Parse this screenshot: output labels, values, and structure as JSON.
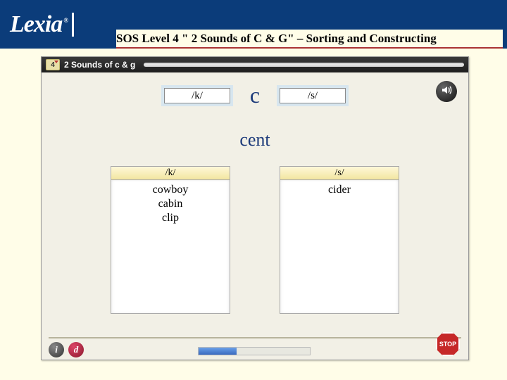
{
  "header": {
    "logo_text": "Lexia",
    "logo_tm": "®",
    "title": "SOS Level 4 \" 2 Sounds of C & G\" – Sorting and Constructing"
  },
  "app": {
    "level_badge": "4",
    "title": "2 Sounds of c & g",
    "top_labels": {
      "left": "/k/",
      "right": "/s/"
    },
    "big_letter": "c",
    "current_word": "cent",
    "columns": [
      {
        "header": "/k/",
        "words": "cowboy\ncabin\nclip"
      },
      {
        "header": "/s/",
        "words": "cider"
      }
    ],
    "buttons": {
      "info": "i",
      "detail": "d",
      "stop": "STOP"
    },
    "progress_percent": 34
  }
}
